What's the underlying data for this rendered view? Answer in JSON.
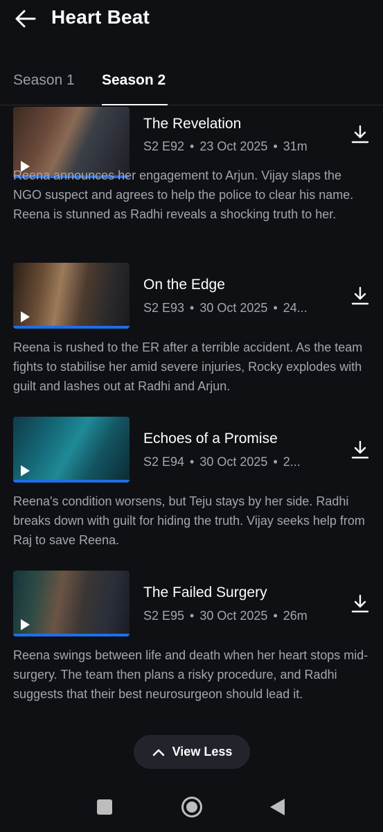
{
  "header": {
    "title": "Heart Beat",
    "back_icon": "arrow-left-icon"
  },
  "tabs": [
    {
      "label": "Season 1",
      "active": false
    },
    {
      "label": "Season 2",
      "active": true
    }
  ],
  "episodes": [
    {
      "title": "The Revelation",
      "code": "S2 E92",
      "date": "23 Oct 2025",
      "duration": "31m",
      "description": "Reena announces her engagement to Arjun. Vijay slaps the NGO suspect and agrees to help the police to clear his name. Reena is stunned as Radhi reveals a shocking truth to her.",
      "progress": 1.0
    },
    {
      "title": "On the Edge",
      "code": "S2 E93",
      "date": "30 Oct 2025",
      "duration": "24...",
      "description": "Reena is rushed to the ER after a terrible accident. As the team fights to stabilise her amid severe injuries, Rocky explodes with guilt and lashes out at Radhi and Arjun.",
      "progress": 1.0
    },
    {
      "title": "Echoes of a Promise",
      "code": "S2 E94",
      "date": "30 Oct 2025",
      "duration": "2...",
      "description": "Reena's condition worsens, but Teju stays by her side. Radhi breaks down with guilt for hiding the truth. Vijay seeks help from Raj to save Reena.",
      "progress": 1.0
    },
    {
      "title": "The Failed Surgery",
      "code": "S2 E95",
      "date": "30 Oct 2025",
      "duration": "26m",
      "description": "Reena swings between life and death when her heart stops mid-surgery. The team then plans a risky procedure, and Radhi suggests that their best neurosurgeon should lead it.",
      "progress": 1.0
    }
  ],
  "meta_separator": "•",
  "view_less_label": "View Less",
  "colors": {
    "background": "#0f1014",
    "progress": "#1f6fe8",
    "muted_text": "#a3a6ae"
  }
}
